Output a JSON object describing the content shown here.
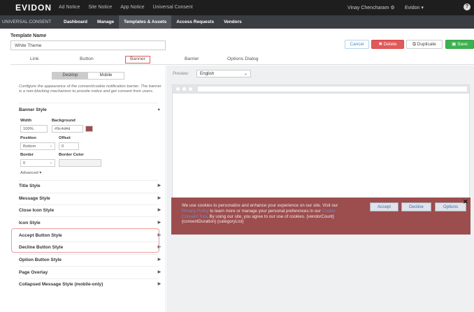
{
  "topbar": {
    "logo": "EVIDON",
    "nav": [
      "Ad Notice",
      "Site Notice",
      "App Notice",
      "Universal Consent"
    ],
    "user": "Vinay Chencharam ⚙",
    "company": "Evidon ▾",
    "help": "?"
  },
  "subbar": {
    "app": "UNIVERSAL CONSENT",
    "nav": [
      "Dashboard",
      "Manage",
      "Templates & Assets",
      "Access Requests",
      "Vendors"
    ]
  },
  "template": {
    "label": "Template Name",
    "value": "White Theme"
  },
  "actions": {
    "cancel": "Cancel",
    "delete": "✖ Delete",
    "duplicate": "Duplicate",
    "save": "Save"
  },
  "tabs": [
    "Link",
    "Button",
    "Banner",
    "Barrier",
    "Options Dialog"
  ],
  "toggle": {
    "desktop": "Desktop",
    "mobile": "Mobile"
  },
  "description": "Configure the appearance of the consent/cookie notification barrier. The banner is a non-blocking mechanism to provide notice and get consent from users.",
  "banner_style": {
    "title": "Banner Style",
    "width_label": "Width",
    "width_value": "100%",
    "background_label": "Background",
    "background_value": "#9c4d4d",
    "position_label": "Position",
    "position_value": "Bottom",
    "offset_label": "Offset",
    "offset_value": "0",
    "border_label": "Border",
    "border_value": "0",
    "border_color_label": "Border Color",
    "advanced": "Advanced ▾"
  },
  "sections": [
    "Title Style",
    "Message Style",
    "Close Icon Style",
    "Icon Style",
    "Accept Button Style",
    "Decline Button Style",
    "Option Button Style",
    "Page Overlay",
    "Collapsed Message Style (mobile-only)"
  ],
  "preview": {
    "label": "Preview:",
    "language": "English"
  },
  "banner": {
    "text_1": "We use cookies to personalize and enhance your experience on our site. Visit our ",
    "link_1": "Privacy Policy",
    "text_2": " to learn more or manage your personal preferences in our ",
    "link_2": "Cookie Consent Tool",
    "text_3": ". By using our site, you agree to our use of cookies. {vendorCount} {consentDuration} {categoryList}",
    "accept": "Accept",
    "decline": "Decline",
    "options": "Options",
    "close": "✕"
  },
  "colors": {
    "banner_bg": "#9c4d4d",
    "save": "#3db24f",
    "delete": "#e05a5a"
  }
}
